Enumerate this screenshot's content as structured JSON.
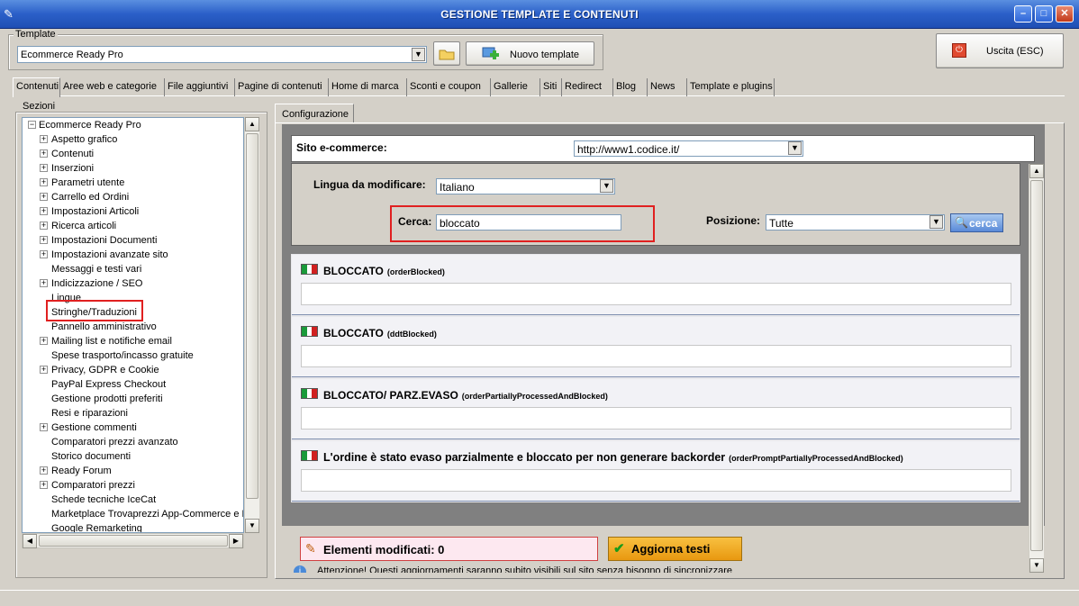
{
  "window": {
    "title": "GESTIONE TEMPLATE E CONTENUTI",
    "minimize": "–",
    "maximize": "□",
    "close": "✕"
  },
  "template": {
    "label": "Template",
    "value": "Ecommerce Ready Pro",
    "new_button": "Nuovo template"
  },
  "exit_button": "Uscita (ESC)",
  "tabs": [
    "Contenuti",
    "Aree web e categorie",
    "File aggiuntivi",
    "Pagine di contenuti",
    "Home di marca",
    "Sconti e coupon",
    "Gallerie",
    "Siti",
    "Redirect",
    "Blog",
    "News",
    "Template e plugins"
  ],
  "sections": {
    "label": "Sezioni",
    "root": "Ecommerce Ready Pro",
    "items": [
      {
        "label": "Aspetto grafico",
        "expandable": true
      },
      {
        "label": "Contenuti",
        "expandable": true
      },
      {
        "label": "Inserzioni",
        "expandable": true
      },
      {
        "label": "Parametri utente",
        "expandable": true
      },
      {
        "label": "Carrello ed Ordini",
        "expandable": true
      },
      {
        "label": "Impostazioni Articoli",
        "expandable": true
      },
      {
        "label": "Ricerca articoli",
        "expandable": true
      },
      {
        "label": "Impostazioni Documenti",
        "expandable": true
      },
      {
        "label": "Impostazioni avanzate sito",
        "expandable": true
      },
      {
        "label": "Messaggi e testi vari",
        "expandable": false
      },
      {
        "label": "Indicizzazione / SEO",
        "expandable": true
      },
      {
        "label": "Lingue",
        "expandable": false
      },
      {
        "label": "Stringhe/Traduzioni",
        "expandable": false,
        "selected": true
      },
      {
        "label": "Pannello amministrativo",
        "expandable": false
      },
      {
        "label": "Mailing list e notifiche email",
        "expandable": true
      },
      {
        "label": "Spese trasporto/incasso gratuite",
        "expandable": false
      },
      {
        "label": "Privacy, GDPR e Cookie",
        "expandable": true
      },
      {
        "label": "PayPal Express Checkout",
        "expandable": false
      },
      {
        "label": "Gestione prodotti preferiti",
        "expandable": false
      },
      {
        "label": "Resi e riparazioni",
        "expandable": false
      },
      {
        "label": "Gestione commenti",
        "expandable": true
      },
      {
        "label": "Comparatori prezzi avanzato",
        "expandable": false
      },
      {
        "label": "Storico documenti",
        "expandable": false
      },
      {
        "label": "Ready Forum",
        "expandable": true
      },
      {
        "label": "Comparatori prezzi",
        "expandable": true
      },
      {
        "label": "Schede tecniche IceCat",
        "expandable": false
      },
      {
        "label": "Marketplace Trovaprezzi App-Commerce e Ki",
        "expandable": false
      },
      {
        "label": "Google Remarketing",
        "expandable": false
      }
    ]
  },
  "config": {
    "tab": "Configurazione",
    "site_label": "Sito e-commerce:",
    "site_value": "http://www1.codice.it/",
    "language_label": "Lingua da modificare:",
    "language_value": "Italiano",
    "search_label": "Cerca:",
    "search_value": "bloccato",
    "position_label": "Posizione:",
    "position_value": "Tutte",
    "search_button": "cerca"
  },
  "strings": [
    {
      "title": "BLOCCATO",
      "key": "(orderBlocked)",
      "value": ""
    },
    {
      "title": "BLOCCATO",
      "key": "(ddtBlocked)",
      "value": ""
    },
    {
      "title": "BLOCCATO/ PARZ.EVASO",
      "key": "(orderPartiallyProcessedAndBlocked)",
      "value": ""
    },
    {
      "title": "L'ordine è stato evaso parzialmente e bloccato per non generare backorder",
      "key": "(orderPromptPartiallyProcessedAndBlocked)",
      "value": ""
    }
  ],
  "footer": {
    "modified_label": "Elementi modificati: 0",
    "update_button": "Aggiorna testi",
    "notice": "Attenzione! Questi aggiornamenti saranno subito visibili sul sito senza bisogno di sincronizzare"
  },
  "colors": {
    "titlebar": "#2b5fc8",
    "highlight": "#e02020",
    "update_button": "#f0a818",
    "modified_bg": "#fde8f0"
  },
  "icons": {
    "app": "wand-icon",
    "folder": "folder-icon",
    "new_template": "new-template-icon",
    "exit": "power-icon",
    "search": "magnifier-icon",
    "pencil": "pencil-icon",
    "check": "check-icon",
    "info": "info-icon",
    "flag": "italian-flag-icon"
  }
}
